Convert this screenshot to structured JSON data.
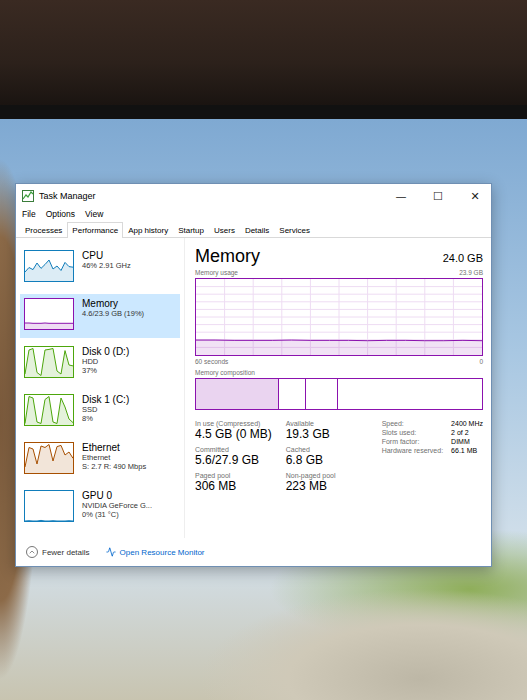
{
  "window": {
    "title": "Task Manager",
    "controls": [
      "—",
      "☐",
      "✕"
    ]
  },
  "menu": [
    "File",
    "Options",
    "View"
  ],
  "tabs": [
    {
      "label": "Processes",
      "selected": false
    },
    {
      "label": "Performance",
      "selected": true
    },
    {
      "label": "App history",
      "selected": false
    },
    {
      "label": "Startup",
      "selected": false
    },
    {
      "label": "Users",
      "selected": false
    },
    {
      "label": "Details",
      "selected": false
    },
    {
      "label": "Services",
      "selected": false
    }
  ],
  "sidebar": {
    "items": [
      {
        "name": "CPU",
        "details": [
          "46% 2.91 GHz"
        ],
        "selected": false,
        "color": "#117dbb",
        "activity": [
          30,
          45,
          38,
          60,
          42,
          55,
          70,
          40,
          50,
          35,
          62,
          48,
          46
        ]
      },
      {
        "name": "Memory",
        "details": [
          "4.6/23.9 GB (19%)"
        ],
        "selected": true,
        "color": "#8b12ae",
        "activity": [
          20,
          20,
          19,
          19,
          19,
          20,
          19,
          19,
          19,
          19,
          19,
          19,
          19
        ]
      },
      {
        "name": "Disk 0 (D:)",
        "details": [
          "HDD",
          "37%"
        ],
        "selected": false,
        "color": "#4da60c",
        "activity": [
          10,
          90,
          95,
          15,
          5,
          90,
          92,
          95,
          20,
          10,
          88,
          40,
          37
        ]
      },
      {
        "name": "Disk 1 (C:)",
        "details": [
          "SSD",
          "8%"
        ],
        "selected": false,
        "color": "#4da60c",
        "activity": [
          5,
          95,
          90,
          10,
          5,
          85,
          95,
          10,
          5,
          90,
          60,
          20,
          8
        ]
      },
      {
        "name": "Ethernet",
        "details": [
          "Ethernet",
          "S: 2.7 R: 490 Mbps"
        ],
        "selected": false,
        "color": "#a74f01",
        "activity": [
          20,
          85,
          80,
          30,
          90,
          85,
          95,
          40,
          88,
          92,
          60,
          70,
          49
        ]
      },
      {
        "name": "GPU 0",
        "details": [
          "NVIDIA GeForce G...",
          "0% (31 °C)"
        ],
        "selected": false,
        "color": "#117dbb",
        "activity": [
          0,
          1,
          0,
          0,
          2,
          0,
          0,
          1,
          0,
          0,
          0,
          1,
          0
        ]
      }
    ]
  },
  "panel": {
    "title": "Memory",
    "total": "24.0 GB",
    "usage_chart": {
      "label": "Memory usage",
      "max": "23.9 GB",
      "start": "60 seconds",
      "end": "0",
      "values": [
        4.7,
        4.7,
        4.6,
        4.6,
        4.6,
        4.7,
        4.6,
        4.6,
        4.6,
        4.5,
        4.6,
        4.6,
        4.5,
        4.5,
        4.6,
        4.5
      ]
    },
    "composition": {
      "label": "Memory composition",
      "segments": [
        {
          "level": 0.29
        },
        {
          "level": 0.09
        },
        {
          "level": 0.11
        },
        {
          "level": 0.51
        }
      ]
    },
    "stats": [
      {
        "label": "In use (Compressed)",
        "value": "4.5 GB (0 MB)"
      },
      {
        "label": "Available",
        "value": "19.3 GB"
      },
      {
        "label": "Committed",
        "value": "5.6/27.9 GB"
      },
      {
        "label": "Cached",
        "value": "6.8 GB"
      },
      {
        "label": "Paged pool",
        "value": "306 MB"
      },
      {
        "label": "Non-paged pool",
        "value": "223 MB"
      }
    ],
    "specs": [
      {
        "label": "Speed:",
        "value": "2400 MHz"
      },
      {
        "label": "Slots used:",
        "value": "2 of 2"
      },
      {
        "label": "Form factor:",
        "value": "DIMM"
      },
      {
        "label": "Hardware reserved:",
        "value": "66.1 MB"
      }
    ]
  },
  "footer": {
    "fewer_details": "Fewer details",
    "resource_monitor": "Open Resource Monitor"
  }
}
